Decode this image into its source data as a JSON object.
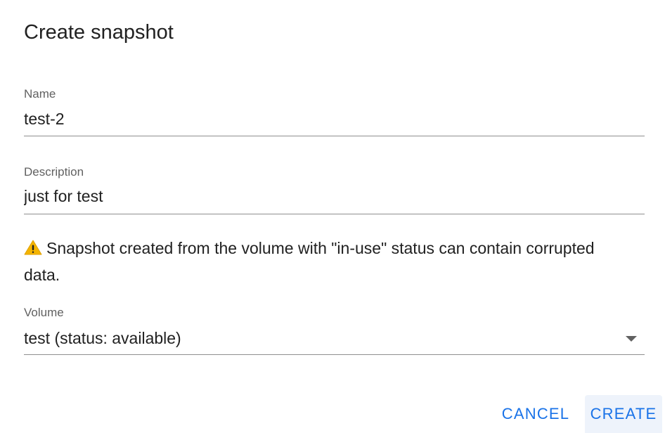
{
  "dialog": {
    "title": "Create snapshot"
  },
  "fields": {
    "name": {
      "label": "Name",
      "value": "test-2"
    },
    "description": {
      "label": "Description",
      "value": "just for test"
    },
    "volume": {
      "label": "Volume",
      "selected": "test (status: available)"
    }
  },
  "warning": {
    "icon": "warning-icon",
    "text": "Snapshot created from the volume with \"in-use\" status can contain corrupted data."
  },
  "actions": {
    "cancel_label": "CANCEL",
    "create_label": "CREATE"
  },
  "colors": {
    "accent": "#1a73e8",
    "warning": "#f4b400",
    "text": "#212121",
    "label": "#616161"
  }
}
